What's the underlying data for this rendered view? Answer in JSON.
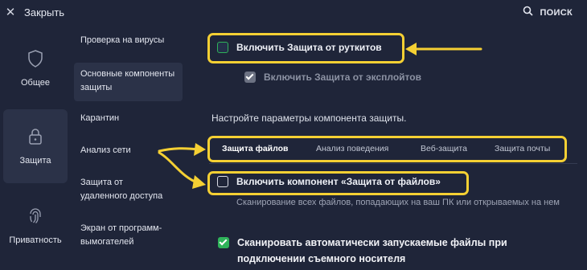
{
  "topbar": {
    "close_label": "Закрыть",
    "search_label": "ПОИСК"
  },
  "left_nav": {
    "items": [
      {
        "label": "Общее",
        "icon": "shield-icon"
      },
      {
        "label": "Защита",
        "icon": "lock-icon",
        "active": true
      },
      {
        "label": "Приватность",
        "icon": "fingerprint-icon"
      }
    ]
  },
  "sub_nav": {
    "items": [
      {
        "label": "Проверка на вирусы"
      },
      {
        "label": "Основные компоненты защиты",
        "active": true
      },
      {
        "label": "Карантин"
      },
      {
        "label": "Анализ сети"
      },
      {
        "label": "Защита от удаленного доступа"
      },
      {
        "label": "Экран от программ-вымогателей"
      }
    ]
  },
  "options": {
    "rootkit_label": "Включить Защита от руткитов",
    "exploit_label": "Включить Защита от эксплойтов"
  },
  "section": {
    "title": "Настройте параметры компонента защиты."
  },
  "tabs": [
    {
      "label": "Защита файлов",
      "active": true
    },
    {
      "label": "Анализ поведения"
    },
    {
      "label": "Веб-защита"
    },
    {
      "label": "Защита почты"
    }
  ],
  "file_shield": {
    "enable_label": "Включить компонент «Защита от файлов»",
    "enable_desc": "Сканирование всех файлов, попадающих на ваш ПК или открываемых на нем",
    "autorun_label": "Сканировать автоматически запускаемые файлы при подключении съемного носителя"
  },
  "colors": {
    "background": "#1f2539",
    "highlight": "#f5d033",
    "check_green": "#2fb35a"
  }
}
